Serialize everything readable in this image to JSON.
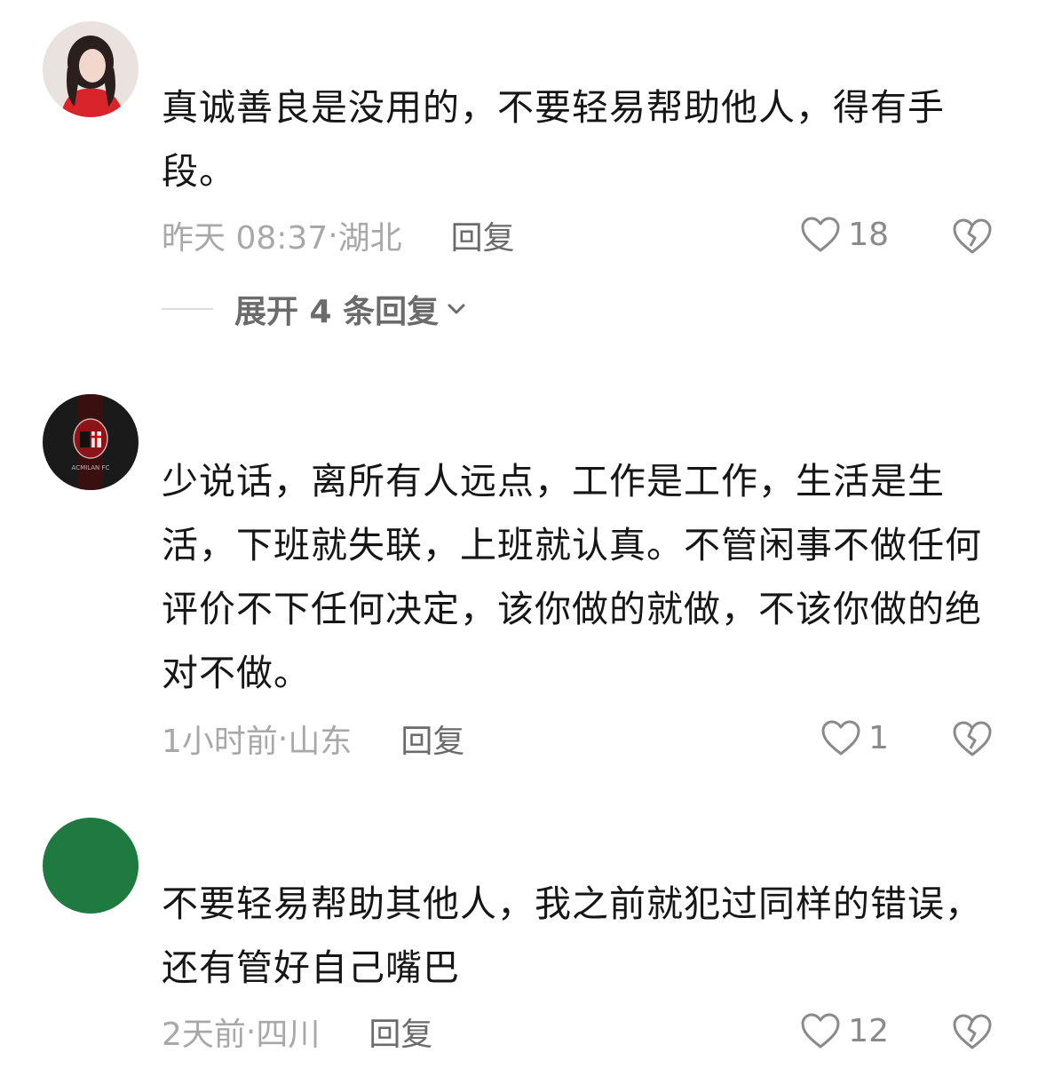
{
  "comments": [
    {
      "text": "真诚善良是没用的，不要轻易帮助他人，得有手段。",
      "time": "昨天 08:37",
      "location": "湖北",
      "reply_label": "回复",
      "likes": "18",
      "avatar_icon": "user-photo-avatar",
      "expand_label": "展开 4 条回复"
    },
    {
      "text": "少说话，离所有人远点，工作是工作，生活是生活，下班就失联，上班就认真。不管闲事不做任何评价不下任何决定，该你做的就做，不该你做的绝对不做。",
      "time": "1小时前",
      "location": "山东",
      "reply_label": "回复",
      "likes": "1",
      "avatar_icon": "club-crest-avatar",
      "avatar_text": "ACMILAN FC"
    },
    {
      "text": "不要轻易帮助其他人，我之前就犯过同样的错误，还有管好自己嘴巴",
      "time": "2天前",
      "location": "四川",
      "reply_label": "回复",
      "likes": "12",
      "avatar_icon": "green-circle-avatar"
    }
  ],
  "meta_separator": "·",
  "colors": {
    "meta": "#a8a8a8",
    "reply": "#6b6b6b",
    "text": "#161616",
    "avatar_green": "#1e7a3e"
  }
}
